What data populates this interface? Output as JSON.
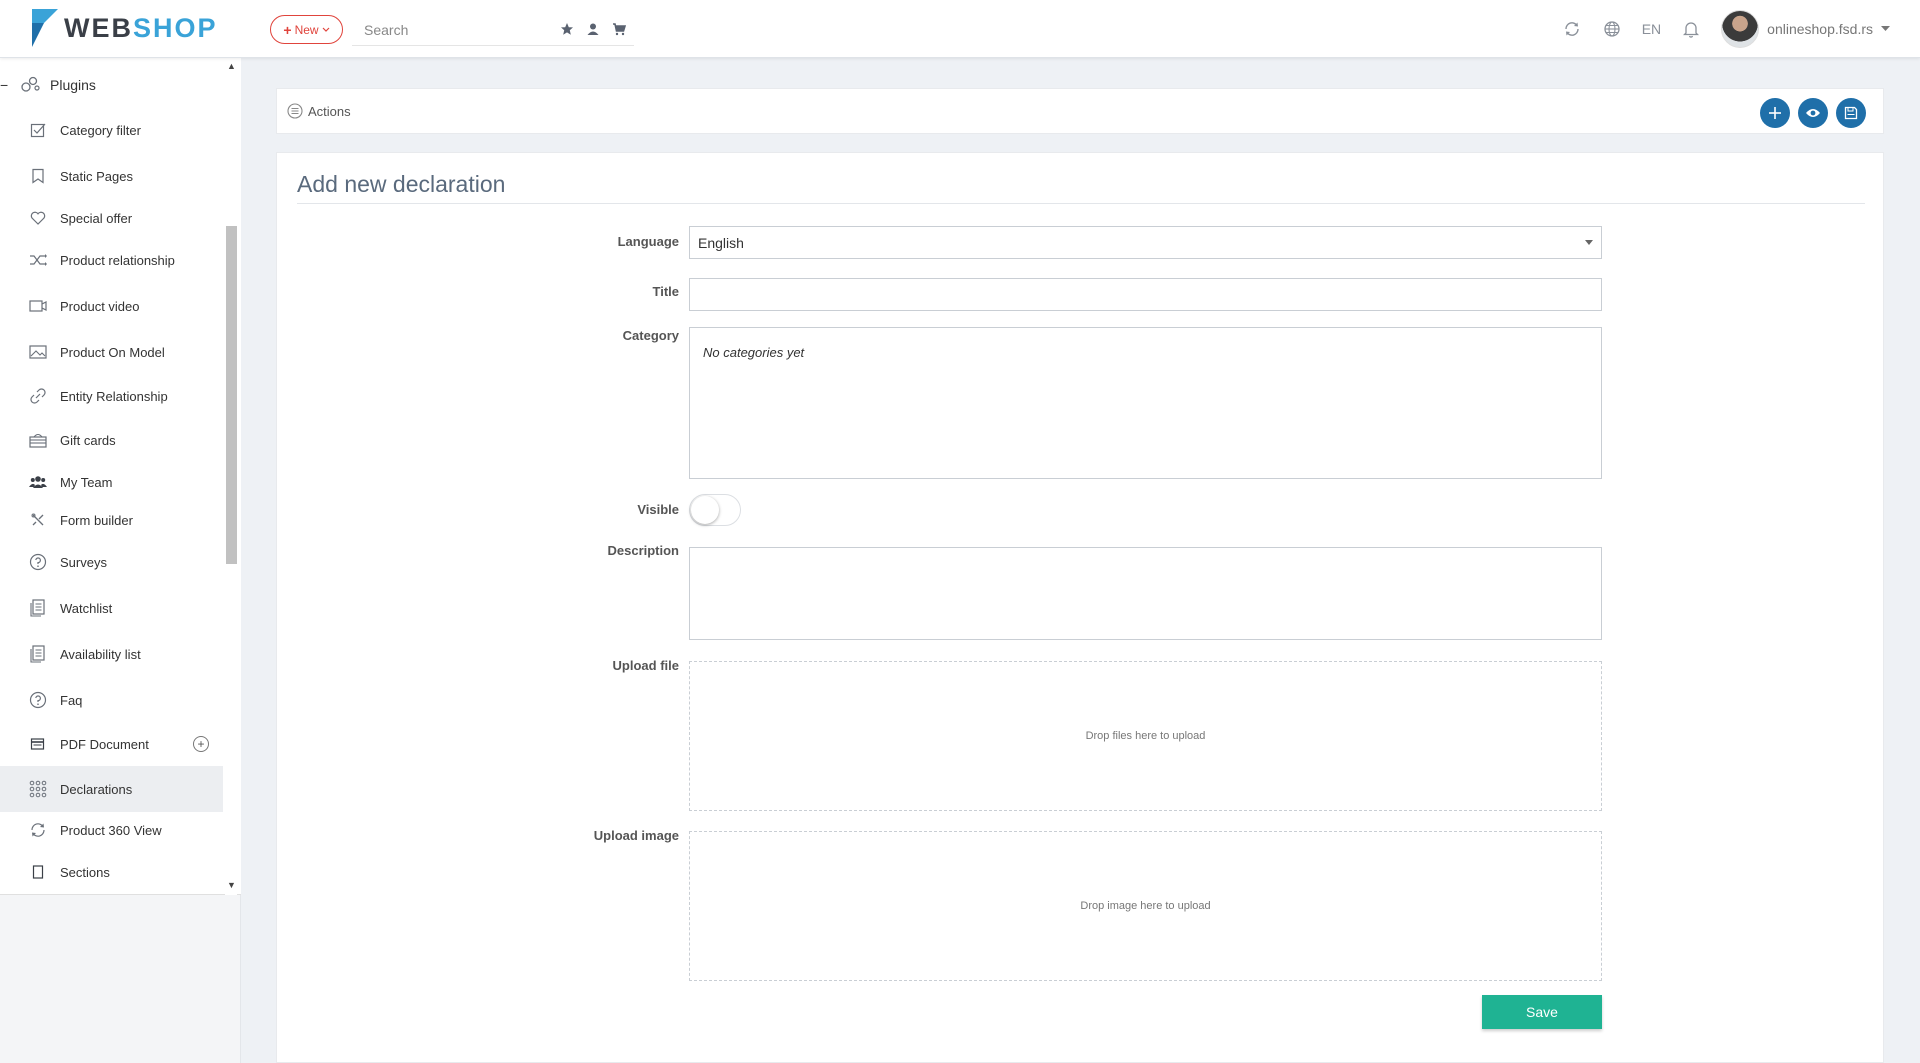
{
  "header": {
    "logo_part1": "WEB",
    "logo_part2": "SHOP",
    "new_label": "New",
    "search_placeholder": "Search",
    "language": "EN",
    "user_name": "onlineshop.fsd.rs"
  },
  "sidebar": {
    "section_label": "Plugins",
    "items": [
      {
        "label": "Category filter",
        "icon": "checkbox-icon"
      },
      {
        "label": "Static Pages",
        "icon": "bookmark-icon"
      },
      {
        "label": "Special offer",
        "icon": "heart-icon"
      },
      {
        "label": "Product relationship",
        "icon": "shuffle-icon"
      },
      {
        "label": "Product video",
        "icon": "video-icon"
      },
      {
        "label": "Product On Model",
        "icon": "image-icon"
      },
      {
        "label": "Entity Relationship",
        "icon": "link-icon"
      },
      {
        "label": "Gift cards",
        "icon": "gift-icon"
      },
      {
        "label": "My Team",
        "icon": "users-icon"
      },
      {
        "label": "Form builder",
        "icon": "tools-icon"
      },
      {
        "label": "Surveys",
        "icon": "question-icon"
      },
      {
        "label": "Watchlist",
        "icon": "list-icon"
      },
      {
        "label": "Availability list",
        "icon": "list-icon"
      },
      {
        "label": "Faq",
        "icon": "question-icon"
      },
      {
        "label": "PDF Document",
        "icon": "document-icon"
      },
      {
        "label": "Declarations",
        "icon": "grid-icon"
      },
      {
        "label": "Product 360 View",
        "icon": "rotate-icon"
      },
      {
        "label": "Sections",
        "icon": "square-icon"
      }
    ]
  },
  "actions": {
    "label": "Actions"
  },
  "form": {
    "title": "Add new declaration",
    "language_label": "Language",
    "language_value": "English",
    "title_label": "Title",
    "title_value": "",
    "category_label": "Category",
    "category_empty": "No categories yet",
    "visible_label": "Visible",
    "description_label": "Description",
    "upload_file_label": "Upload file",
    "upload_file_hint": "Drop files here to upload",
    "upload_image_label": "Upload image",
    "upload_image_hint": "Drop image here to upload",
    "save_label": "Save"
  },
  "colors": {
    "accent": "#1f6fa9",
    "save": "#1fb393",
    "new_button": "#e0443c"
  }
}
